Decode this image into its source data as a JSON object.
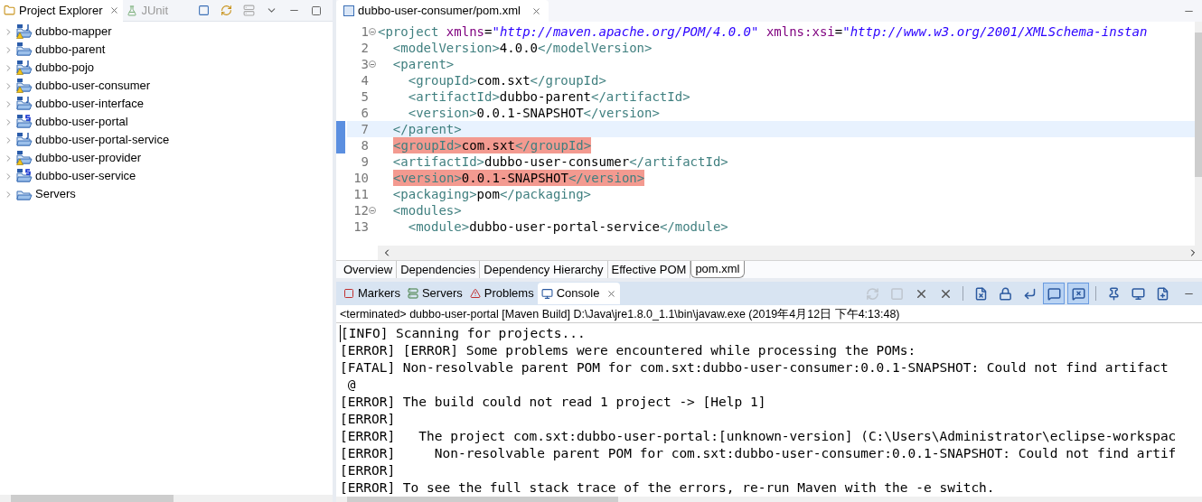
{
  "explorer": {
    "tabs": [
      {
        "label": "Project Explorer",
        "kind": "explorer",
        "selected": true
      },
      {
        "label": "JUnit",
        "kind": "junit",
        "selected": false
      }
    ],
    "items": [
      {
        "label": "dubbo-mapper",
        "kind": "maven-java",
        "warning": true,
        "expanded": false
      },
      {
        "label": "dubbo-parent",
        "kind": "maven",
        "warning": false,
        "expanded": false
      },
      {
        "label": "dubbo-pojo",
        "kind": "maven-java",
        "warning": true,
        "expanded": false
      },
      {
        "label": "dubbo-user-consumer",
        "kind": "maven",
        "warning": true,
        "expanded": false
      },
      {
        "label": "dubbo-user-interface",
        "kind": "maven-java",
        "warning": false,
        "expanded": false
      },
      {
        "label": "dubbo-user-portal",
        "kind": "maven-spring",
        "warning": false,
        "expanded": false
      },
      {
        "label": "dubbo-user-portal-service",
        "kind": "maven-java",
        "warning": false,
        "expanded": false
      },
      {
        "label": "dubbo-user-provider",
        "kind": "maven",
        "warning": true,
        "expanded": false
      },
      {
        "label": "dubbo-user-service",
        "kind": "maven-spring",
        "warning": false,
        "expanded": false
      },
      {
        "label": "Servers",
        "kind": "folder",
        "warning": false,
        "expanded": false
      }
    ]
  },
  "editor": {
    "tab": "dubbo-user-consumer/pom.xml",
    "lines": [
      {
        "number": "1",
        "fold": true,
        "current": false,
        "error": false,
        "changed": false,
        "tokens": [
          {
            "kind": "tag",
            "text": "<project"
          },
          {
            "kind": "attr",
            "text": " xmlns"
          },
          {
            "kind": "text",
            "text": "="
          },
          {
            "kind": "string",
            "text": "\"http://maven.apache.org/POM/4.0.0\""
          },
          {
            "kind": "attr",
            "text": " xmlns:xsi"
          },
          {
            "kind": "text",
            "text": "="
          },
          {
            "kind": "string",
            "text": "\"http://www.w3.org/2001/XMLSchema-instan"
          }
        ]
      },
      {
        "number": "2",
        "fold": false,
        "current": false,
        "error": false,
        "changed": false,
        "tokens": [
          {
            "kind": "tag",
            "text": "  <modelVersion>"
          },
          {
            "kind": "text",
            "text": "4.0.0"
          },
          {
            "kind": "tag",
            "text": "</modelVersion>"
          }
        ]
      },
      {
        "number": "3",
        "fold": true,
        "current": false,
        "error": false,
        "changed": false,
        "tokens": [
          {
            "kind": "tag",
            "text": "  <parent>"
          }
        ]
      },
      {
        "number": "4",
        "fold": false,
        "current": false,
        "error": false,
        "changed": false,
        "tokens": [
          {
            "kind": "tag",
            "text": "    <groupId>"
          },
          {
            "kind": "text",
            "text": "com.sxt"
          },
          {
            "kind": "tag",
            "text": "</groupId>"
          }
        ]
      },
      {
        "number": "5",
        "fold": false,
        "current": false,
        "error": false,
        "changed": false,
        "tokens": [
          {
            "kind": "tag",
            "text": "    <artifactId>"
          },
          {
            "kind": "text",
            "text": "dubbo-parent"
          },
          {
            "kind": "tag",
            "text": "</artifactId>"
          }
        ]
      },
      {
        "number": "6",
        "fold": false,
        "current": false,
        "error": false,
        "changed": false,
        "tokens": [
          {
            "kind": "tag",
            "text": "    <version>"
          },
          {
            "kind": "text",
            "text": "0.0.1-SNAPSHOT"
          },
          {
            "kind": "tag",
            "text": "</version>"
          }
        ]
      },
      {
        "number": "7",
        "fold": false,
        "current": true,
        "error": false,
        "changed": true,
        "tokens": [
          {
            "kind": "tag",
            "text": "  </parent>"
          }
        ]
      },
      {
        "number": "8",
        "fold": false,
        "current": false,
        "error": true,
        "changed": true,
        "tokens": [
          {
            "kind": "tag",
            "text": "<groupId>"
          },
          {
            "kind": "text",
            "text": "com.sxt"
          },
          {
            "kind": "tag",
            "text": "</groupId>"
          }
        ]
      },
      {
        "number": "9",
        "fold": false,
        "current": false,
        "error": false,
        "changed": false,
        "tokens": [
          {
            "kind": "tag",
            "text": "  <artifactId>"
          },
          {
            "kind": "text",
            "text": "dubbo-user-consumer"
          },
          {
            "kind": "tag",
            "text": "</artifactId>"
          }
        ]
      },
      {
        "number": "10",
        "fold": false,
        "current": false,
        "error": true,
        "changed": false,
        "tokens": [
          {
            "kind": "tag",
            "text": "<version>"
          },
          {
            "kind": "text",
            "text": "0.0.1-SNAPSHOT"
          },
          {
            "kind": "tag",
            "text": "</version>"
          }
        ]
      },
      {
        "number": "11",
        "fold": false,
        "current": false,
        "error": false,
        "changed": false,
        "tokens": [
          {
            "kind": "tag",
            "text": "  <packaging>"
          },
          {
            "kind": "text",
            "text": "pom"
          },
          {
            "kind": "tag",
            "text": "</packaging>"
          }
        ]
      },
      {
        "number": "12",
        "fold": true,
        "current": false,
        "error": false,
        "changed": false,
        "tokens": [
          {
            "kind": "tag",
            "text": "  <modules>"
          }
        ]
      },
      {
        "number": "13",
        "fold": false,
        "current": false,
        "error": false,
        "changed": false,
        "tokens": [
          {
            "kind": "tag",
            "text": "    <module>"
          },
          {
            "kind": "text",
            "text": "dubbo-user-portal-service"
          },
          {
            "kind": "tag",
            "text": "</module>"
          }
        ]
      }
    ],
    "pages": [
      {
        "label": "Overview",
        "selected": false
      },
      {
        "label": "Dependencies",
        "selected": false
      },
      {
        "label": "Dependency Hierarchy",
        "selected": false
      },
      {
        "label": "Effective POM",
        "selected": false
      },
      {
        "label": "pom.xml",
        "selected": true
      }
    ]
  },
  "console": {
    "tabs": [
      {
        "label": "Markers",
        "kind": "markers",
        "selected": false
      },
      {
        "label": "Servers",
        "kind": "servers",
        "selected": false
      },
      {
        "label": "Problems",
        "kind": "problems",
        "selected": false
      },
      {
        "label": "Console",
        "kind": "console",
        "selected": true
      }
    ],
    "toolbar": [
      [
        {
          "kind": "refresh",
          "disabled": true,
          "selected": false
        },
        {
          "kind": "stop",
          "disabled": true,
          "selected": false
        },
        {
          "kind": "remove",
          "disabled": false,
          "selected": false
        },
        {
          "kind": "remove-all",
          "disabled": false,
          "selected": false
        }
      ],
      [
        {
          "kind": "clear",
          "disabled": false,
          "selected": false
        },
        {
          "kind": "lock",
          "disabled": false,
          "selected": false
        },
        {
          "kind": "wrap",
          "disabled": false,
          "selected": false
        },
        {
          "kind": "stdout",
          "disabled": false,
          "selected": true
        },
        {
          "kind": "stderr",
          "disabled": false,
          "selected": true
        }
      ],
      [
        {
          "kind": "pin",
          "disabled": false,
          "selected": false
        },
        {
          "kind": "display",
          "disabled": false,
          "selected": false
        },
        {
          "kind": "open",
          "disabled": false,
          "selected": false
        }
      ]
    ],
    "status": "<terminated> dubbo-user-portal [Maven Build] D:\\Java\\jre1.8.0_1.1\\bin\\javaw.exe (2019年4月12日 下午4:13:48)",
    "lines": [
      "[INFO] Scanning for projects...",
      "[ERROR] [ERROR] Some problems were encountered while processing the POMs:",
      "[FATAL] Non-resolvable parent POM for com.sxt:dubbo-user-consumer:0.0.1-SNAPSHOT: Could not find artifact",
      " @",
      "[ERROR] The build could not read 1 project -> [Help 1]",
      "[ERROR]",
      "[ERROR]   The project com.sxt:dubbo-user-portal:[unknown-version] (C:\\Users\\Administrator\\eclipse-workspac",
      "[ERROR]     Non-resolvable parent POM for com.sxt:dubbo-user-consumer:0.0.1-SNAPSHOT: Could not find artif",
      "[ERROR]",
      "[ERROR] To see the full stack trace of the errors, re-run Maven with the -e switch."
    ]
  }
}
